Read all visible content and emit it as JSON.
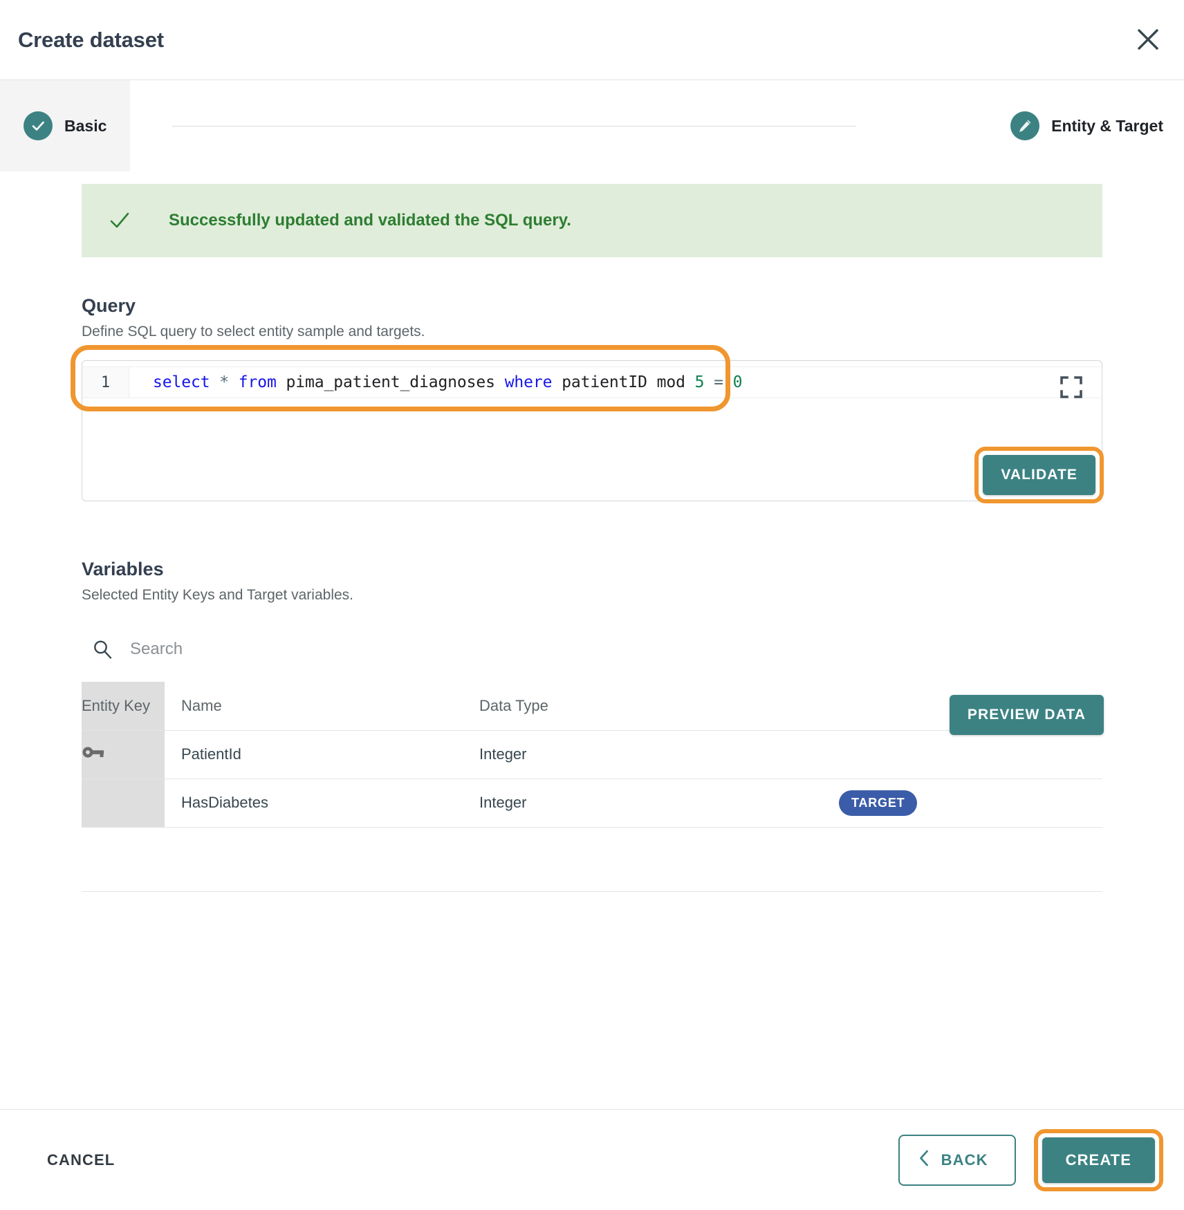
{
  "header": {
    "title": "Create dataset",
    "close_icon": "close-icon"
  },
  "stepper": {
    "steps": [
      {
        "label": "Basic",
        "icon": "check-icon",
        "state": "completed"
      },
      {
        "label": "Entity & Target",
        "icon": "pencil-icon",
        "state": "active"
      }
    ]
  },
  "alert": {
    "icon": "check-icon",
    "message": "Successfully updated and validated the SQL query.",
    "bg_color": "#dfedda",
    "text_color": "#2e7d32"
  },
  "query": {
    "title": "Query",
    "subtitle": "Define SQL query to select entity sample and targets.",
    "validate_label": "VALIDATE",
    "line_number": "1",
    "sql_tokens": [
      {
        "text": "select",
        "type": "keyword"
      },
      {
        "text": " ",
        "type": "plain"
      },
      {
        "text": "*",
        "type": "operator"
      },
      {
        "text": " ",
        "type": "plain"
      },
      {
        "text": "from",
        "type": "keyword"
      },
      {
        "text": " ",
        "type": "plain"
      },
      {
        "text": "pima_patient_diagnoses",
        "type": "identifier"
      },
      {
        "text": " ",
        "type": "plain"
      },
      {
        "text": "where",
        "type": "keyword"
      },
      {
        "text": " ",
        "type": "plain"
      },
      {
        "text": "patientID mod",
        "type": "identifier"
      },
      {
        "text": " ",
        "type": "plain"
      },
      {
        "text": "5",
        "type": "number"
      },
      {
        "text": " ",
        "type": "plain"
      },
      {
        "text": "=",
        "type": "operator"
      },
      {
        "text": " ",
        "type": "plain"
      },
      {
        "text": "0",
        "type": "number"
      }
    ],
    "sql_text": "select * from pima_patient_diagnoses where patientID mod 5 = 0",
    "expand_icon": "fullscreen-expand-icon",
    "resize_handle": "resize-grip-icon"
  },
  "variables": {
    "title": "Variables",
    "subtitle": "Selected Entity Keys and Target variables.",
    "preview_label": "PREVIEW DATA",
    "search_placeholder": "Search",
    "search_value": "",
    "search_icon": "search-icon",
    "columns": [
      "Entity Key",
      "Name",
      "Data Type",
      ""
    ],
    "rows": [
      {
        "entity_key": true,
        "key_icon": "key-icon",
        "name": "PatientId",
        "data_type": "Integer",
        "badge": ""
      },
      {
        "entity_key": false,
        "key_icon": "",
        "name": "HasDiabetes",
        "data_type": "Integer",
        "badge": "TARGET"
      }
    ]
  },
  "footer": {
    "cancel_label": "CANCEL",
    "back_label": "BACK",
    "back_icon": "chevron-left-icon",
    "create_label": "CREATE"
  },
  "colors": {
    "accent_teal": "#3c8283",
    "highlight_orange": "#f0962f",
    "badge_blue": "#3b5ca8",
    "success_green": "#2e7d32"
  }
}
